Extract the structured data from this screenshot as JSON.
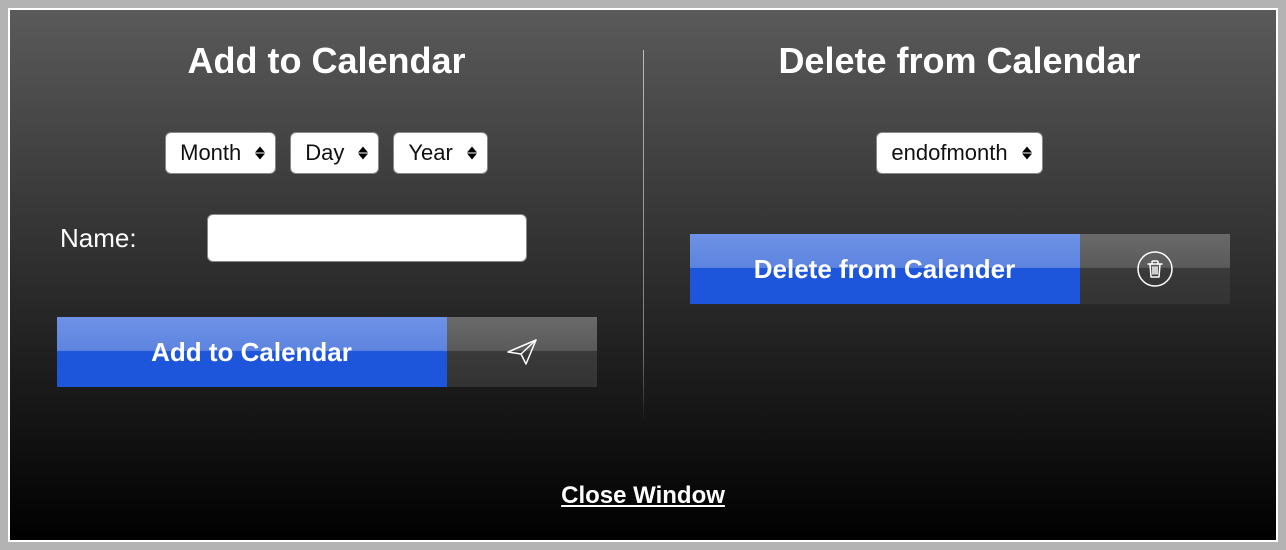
{
  "add": {
    "title": "Add to Calendar",
    "month_label": "Month",
    "day_label": "Day",
    "year_label": "Year",
    "name_label": "Name:",
    "name_value": "",
    "button_label": "Add to Calendar"
  },
  "delete": {
    "title": "Delete from Calendar",
    "select_value": "endofmonth",
    "button_label": "Delete from Calender"
  },
  "close_label": "Close Window"
}
